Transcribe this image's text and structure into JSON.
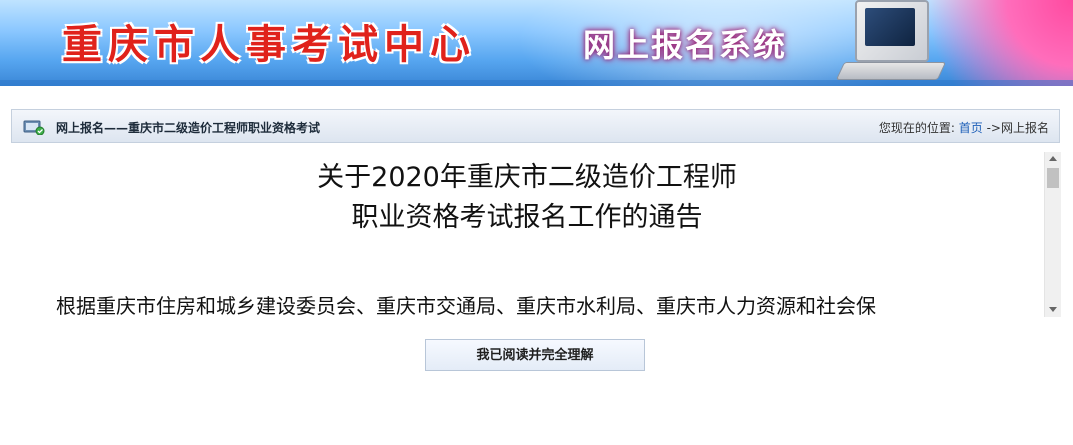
{
  "header": {
    "site_title": "重庆市人事考试中心",
    "system_title": "网上报名系统"
  },
  "breadcrumb_bar": {
    "section_title": "网上报名——重庆市二级造价工程师职业资格考试",
    "location_prefix": "您现在的位置:",
    "home_link": "首页",
    "separator": "->",
    "current_page": "网上报名"
  },
  "notice": {
    "title_line1": "关于2020年重庆市二级造价工程师",
    "title_line2": "职业资格考试报名工作的通告",
    "body_first_line": "根据重庆市住房和城乡建设委员会、重庆市交通局、重庆市水利局、重庆市人力资源和社会保"
  },
  "actions": {
    "confirm_label": "我已阅读并完全理解"
  },
  "colors": {
    "site_title": "#e0221b",
    "banner_blue": "#57a6f0",
    "link_blue": "#1d5fb8"
  },
  "icons": {
    "breadcrumb_icon": "monitor-list-icon"
  }
}
